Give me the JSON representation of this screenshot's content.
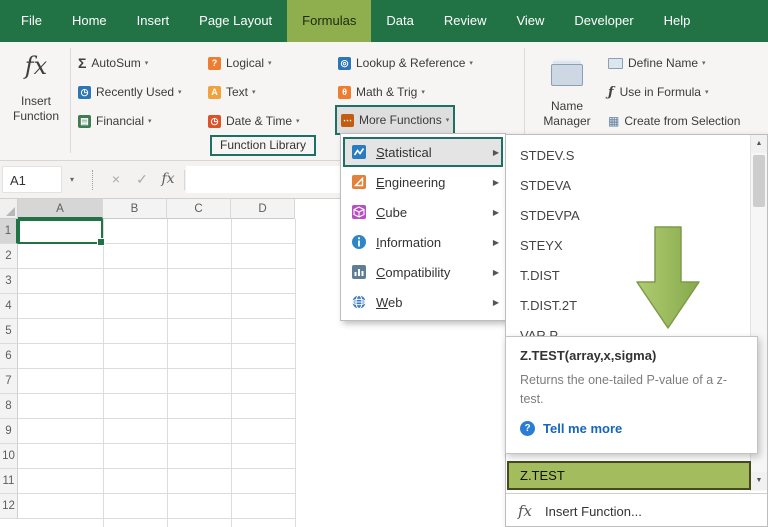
{
  "tabs": [
    "File",
    "Home",
    "Insert",
    "Page Layout",
    "Formulas",
    "Data",
    "Review",
    "View",
    "Developer",
    "Help"
  ],
  "active_tab": "Formulas",
  "ribbon": {
    "insert_function": {
      "line1": "Insert",
      "line2": "Function"
    },
    "autosum": "AutoSum",
    "recently_used": "Recently Used",
    "financial": "Financial",
    "logical": "Logical",
    "text": "Text",
    "date_time": "Date & Time",
    "lookup_reference": "Lookup & Reference",
    "math_trig": "Math & Trig",
    "more_functions": "More Functions",
    "function_library": "Function Library",
    "name_manager": {
      "line1": "Name",
      "line2": "Manager"
    },
    "define_name": "Define Name",
    "use_in_formula": "Use in Formula",
    "create_from_selection": "Create from Selection"
  },
  "formula_bar": {
    "name_box": "A1",
    "cancel": "×",
    "enter": "✓",
    "fx": "fx"
  },
  "grid": {
    "columns": [
      "A",
      "B",
      "C",
      "D"
    ],
    "rows": [
      "1",
      "2",
      "3",
      "4",
      "5",
      "6",
      "7",
      "8",
      "9",
      "10",
      "11",
      "12"
    ],
    "selected_cell": "A1"
  },
  "menu": {
    "items": [
      {
        "key": "S",
        "rest": "tatistical",
        "selected": true
      },
      {
        "key": "E",
        "rest": "ngineering"
      },
      {
        "key": "C",
        "rest": "ube"
      },
      {
        "key": "I",
        "rest": "nformation"
      },
      {
        "key": "C",
        "rest": "ompatibility"
      },
      {
        "key": "W",
        "rest": "eb"
      }
    ]
  },
  "function_list": {
    "items": [
      "STDEV.S",
      "STDEVA",
      "STDEVPA",
      "STEYX",
      "T.DIST",
      "T.DIST.2T",
      "VAR.P"
    ],
    "highlighted": "Z.TEST",
    "insert_function": "Insert Function..."
  },
  "tooltip": {
    "title": "Z.TEST(array,x,sigma)",
    "description": "Returns the one-tailed P-value of a z-test.",
    "link": "Tell me more"
  },
  "icons": {
    "fx_large": "fx",
    "sigma": "Σ",
    "caret": "▾",
    "name_caret": "▾",
    "submenu_arrow": "▶",
    "scroll_up": "▲",
    "scroll_down": "▼",
    "clock": "◷",
    "question": "?",
    "letter_a": "A",
    "theta": "θ",
    "dots": "⋯",
    "bank": "▤",
    "lookup": "◎",
    "grid": "▦",
    "fx_small": "ƒ",
    "help_q": "?"
  },
  "colors": {
    "excel_green": "#217346",
    "active_tab_green": "#8fae4e",
    "highlight_border_teal": "#1e6f66",
    "ztest_fill": "#a3bc5e",
    "arrow_green": "#9cbf5d",
    "link_blue": "#1565c0"
  }
}
